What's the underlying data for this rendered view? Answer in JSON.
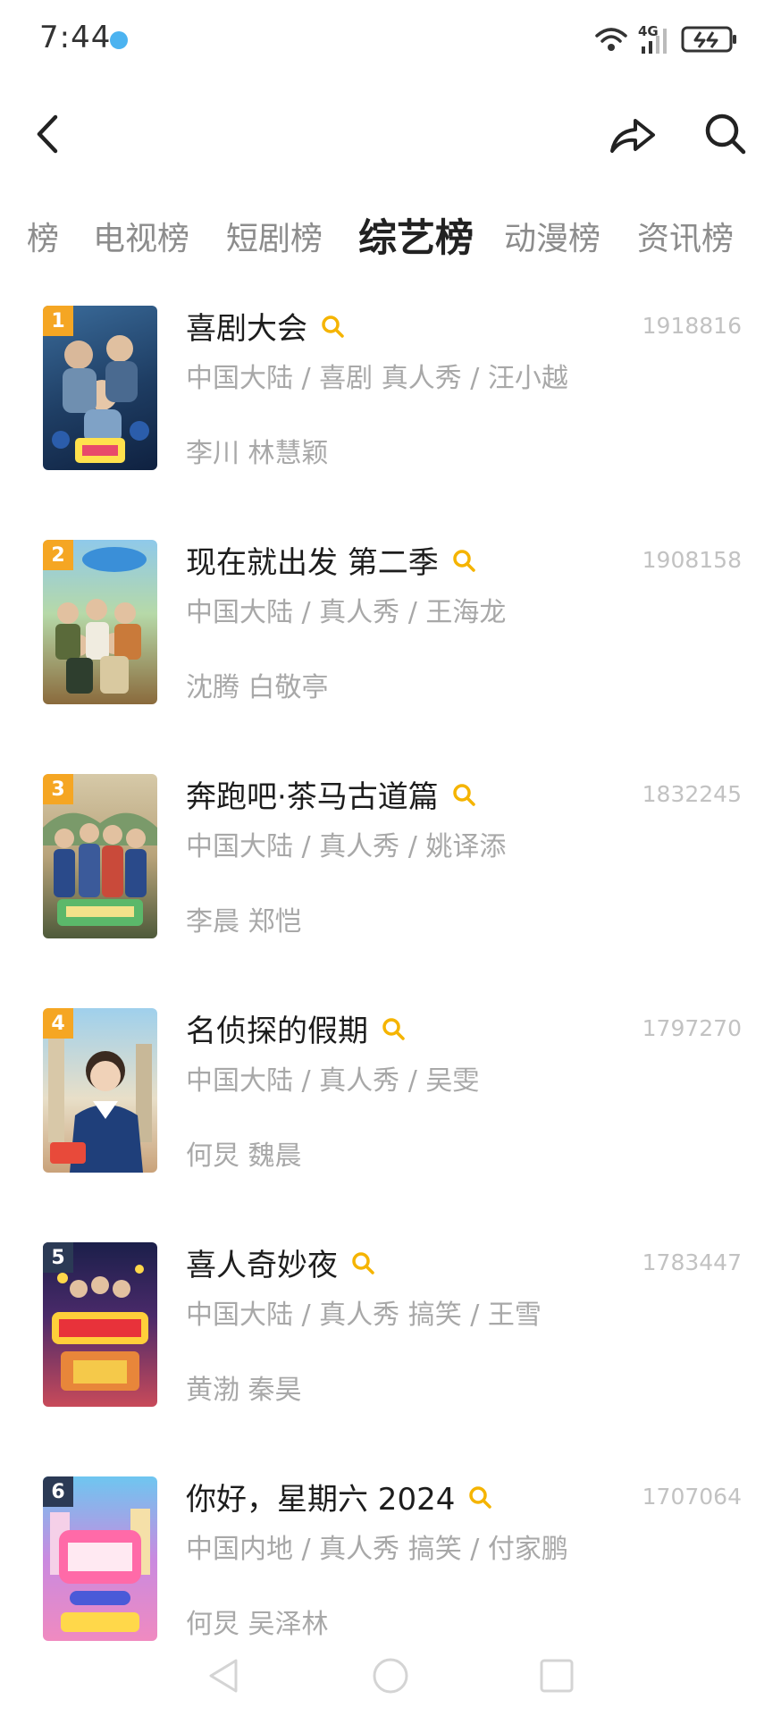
{
  "status": {
    "time": "7:44",
    "network": "4G"
  },
  "tabs": [
    {
      "label": "榜",
      "active": false
    },
    {
      "label": "电视榜",
      "active": false
    },
    {
      "label": "短剧榜",
      "active": false
    },
    {
      "label": "综艺榜",
      "active": true
    },
    {
      "label": "动漫榜",
      "active": false
    },
    {
      "label": "资讯榜",
      "active": false
    }
  ],
  "list": [
    {
      "rank": "1",
      "title": "喜剧大会",
      "meta": "中国大陆 / 喜剧 真人秀 / 汪小越",
      "cast": "李川 林慧颖",
      "score": "1918816"
    },
    {
      "rank": "2",
      "title": "现在就出发 第二季",
      "meta": "中国大陆 / 真人秀 / 王海龙",
      "cast": "沈腾 白敬亭",
      "score": "1908158"
    },
    {
      "rank": "3",
      "title": "奔跑吧·茶马古道篇",
      "meta": "中国大陆 / 真人秀 / 姚译添",
      "cast": "李晨 郑恺",
      "score": "1832245"
    },
    {
      "rank": "4",
      "title": "名侦探的假期",
      "meta": "中国大陆 / 真人秀 / 吴雯",
      "cast": "何炅 魏晨",
      "score": "1797270"
    },
    {
      "rank": "5",
      "title": "喜人奇妙夜",
      "meta": "中国大陆 / 真人秀 搞笑 / 王雪",
      "cast": "黄渤 秦昊",
      "score": "1783447"
    },
    {
      "rank": "6",
      "title": "你好，星期六 2024",
      "meta": "中国内地 / 真人秀 搞笑 / 付家鹏",
      "cast": "何炅 吴泽林",
      "score": "1707064"
    }
  ],
  "colors": {
    "rank_top3": "#f5a623",
    "rank_other": "#2b3a55",
    "search_accent": "#f5b400"
  }
}
